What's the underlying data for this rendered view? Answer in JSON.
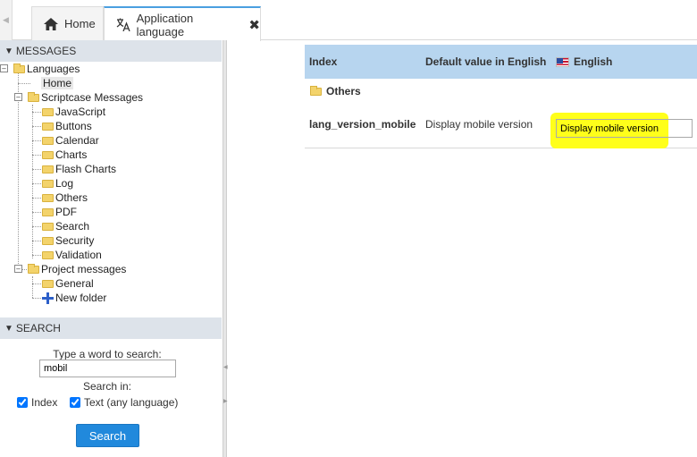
{
  "tabs": [
    {
      "label": "Home",
      "icon": "home-icon",
      "active": false
    },
    {
      "label": "Application language",
      "icon": "translate-icon",
      "active": true
    }
  ],
  "messages_panel": {
    "title": "MESSAGES",
    "tree": {
      "root": "Languages",
      "home": "Home",
      "scriptcase": {
        "label": "Scriptcase Messages",
        "children": [
          "JavaScript",
          "Buttons",
          "Calendar",
          "Charts",
          "Flash Charts",
          "Log",
          "Others",
          "PDF",
          "Search",
          "Security",
          "Validation"
        ]
      },
      "project": {
        "label": "Project messages",
        "children": [
          "General"
        ]
      },
      "new_folder": "New folder"
    }
  },
  "search_panel": {
    "title": "SEARCH",
    "prompt": "Type a word to search:",
    "query": "mobil",
    "search_in_label": "Search in:",
    "options": [
      {
        "label": "Index",
        "checked": true
      },
      {
        "label": "Text (any language)",
        "checked": true
      }
    ],
    "button": "Search"
  },
  "table": {
    "headers": {
      "index": "Index",
      "default": "Default value in English",
      "language": "English"
    },
    "group": "Others",
    "rows": [
      {
        "index": "lang_version_mobile",
        "default": "Display mobile version",
        "value": "Display mobile version"
      }
    ]
  },
  "colors": {
    "accent": "#2189dc",
    "header_bg": "#b7d5ef",
    "highlight": "#ffff1a",
    "panel_head_bg": "#dde3ea"
  }
}
